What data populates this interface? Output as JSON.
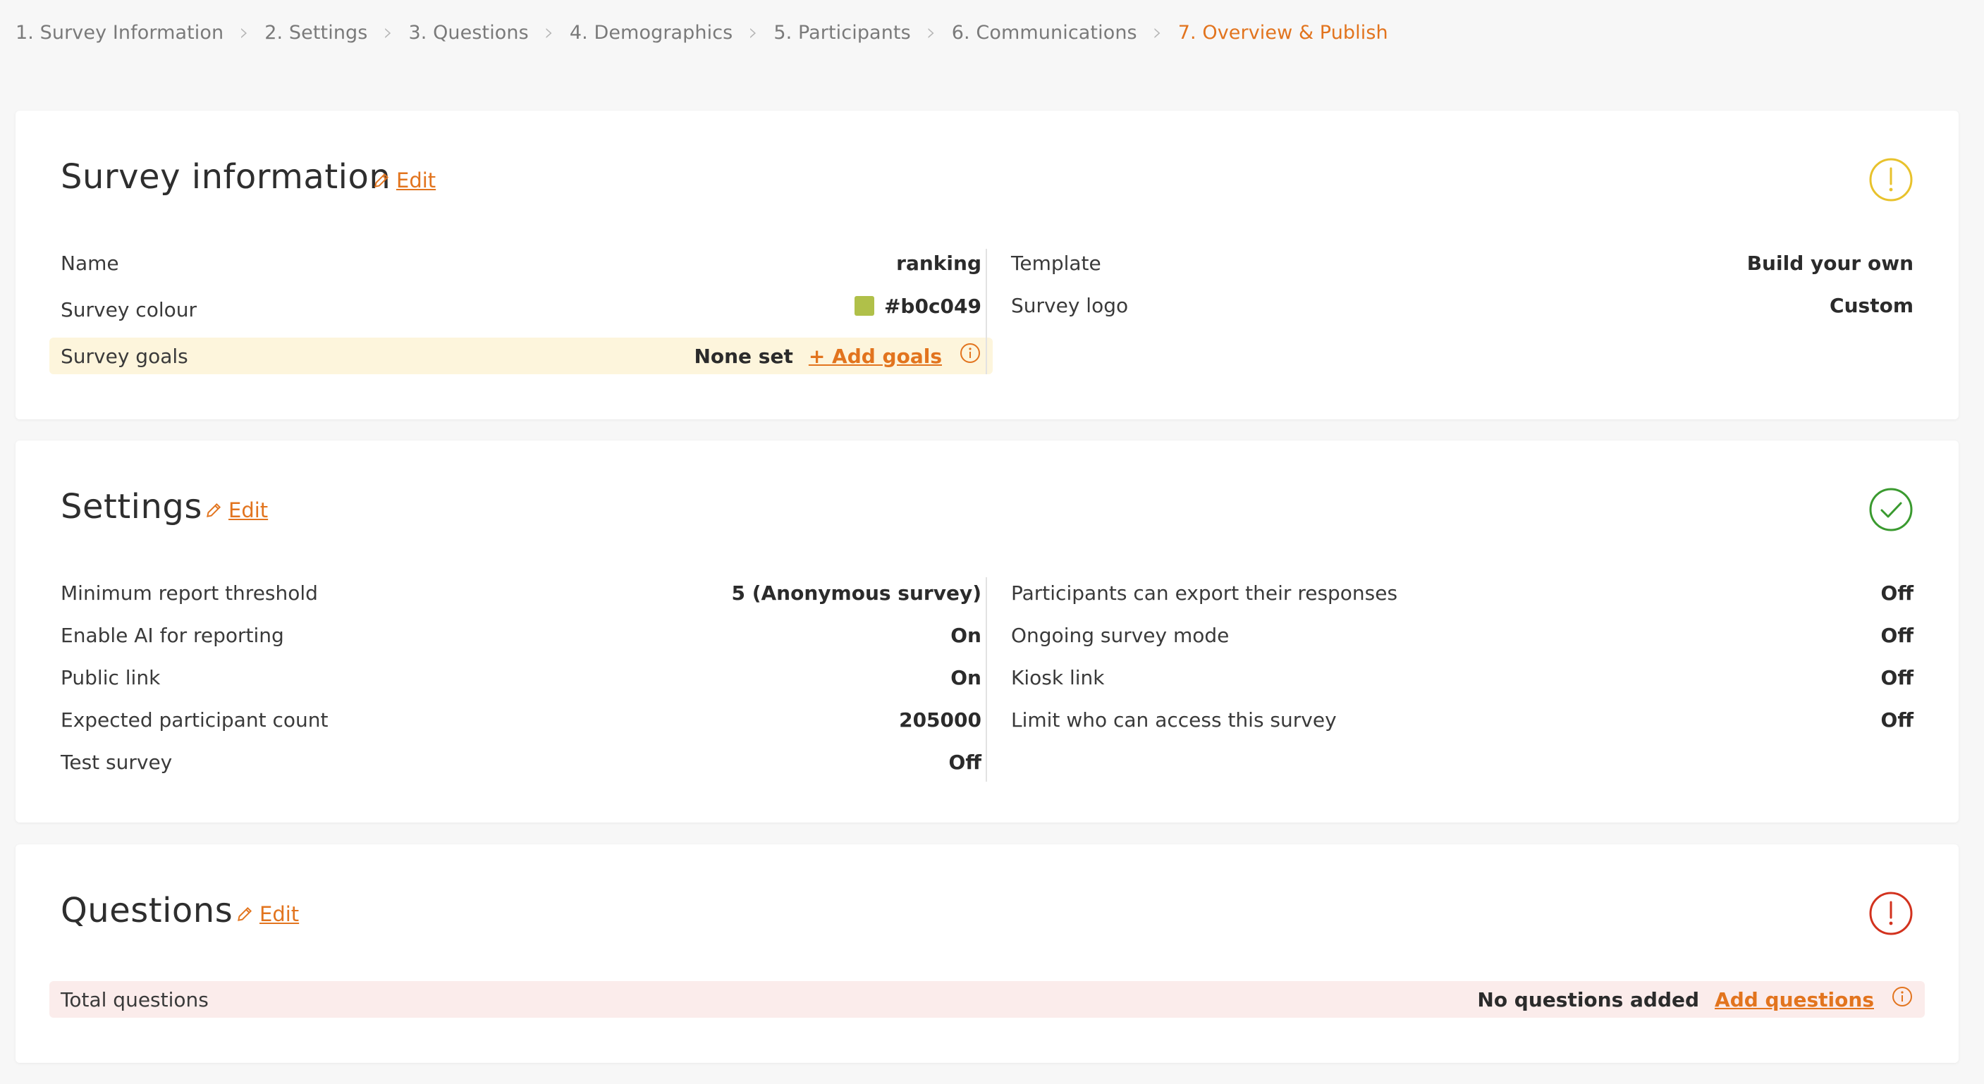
{
  "stepper": {
    "steps": [
      {
        "label": "1. Survey Information"
      },
      {
        "label": "2. Settings"
      },
      {
        "label": "3. Questions"
      },
      {
        "label": "4. Demographics"
      },
      {
        "label": "5. Participants"
      },
      {
        "label": "6. Communications"
      },
      {
        "label": "7. Overview & Publish"
      }
    ],
    "active_index": 6
  },
  "colors": {
    "accent": "#e2741e",
    "warning": "#e8c22c",
    "success": "#3a9a2f",
    "error": "#d2321e",
    "survey_colour_swatch": "#b0c049"
  },
  "survey_info": {
    "title": "Survey information",
    "edit_label": "Edit",
    "status_icon": "warning-icon",
    "left": [
      {
        "label": "Name",
        "value": "ranking"
      },
      {
        "label": "Survey colour",
        "value": "#b0c049"
      },
      {
        "label": "Survey goals",
        "value": "None set",
        "action": "+ Add goals"
      }
    ],
    "right": [
      {
        "label": "Template",
        "value": "Build your own"
      },
      {
        "label": "Survey logo",
        "value": "Custom"
      }
    ]
  },
  "settings": {
    "title": "Settings",
    "edit_label": "Edit",
    "status_icon": "check-icon",
    "left": [
      {
        "label": "Minimum report threshold",
        "value": "5 (Anonymous survey)"
      },
      {
        "label": "Enable AI for reporting",
        "value": "On"
      },
      {
        "label": "Public link",
        "value": "On"
      },
      {
        "label": "Expected participant count",
        "value": "205000"
      },
      {
        "label": "Test survey",
        "value": "Off"
      }
    ],
    "right": [
      {
        "label": "Participants can export their responses",
        "value": "Off"
      },
      {
        "label": "Ongoing survey mode",
        "value": "Off"
      },
      {
        "label": "Kiosk link",
        "value": "Off"
      },
      {
        "label": "Limit who can access this survey",
        "value": "Off"
      }
    ]
  },
  "questions": {
    "title": "Questions",
    "edit_label": "Edit",
    "status_icon": "error-icon",
    "total_label": "Total questions",
    "total_value": "No questions added",
    "action": "Add questions"
  }
}
